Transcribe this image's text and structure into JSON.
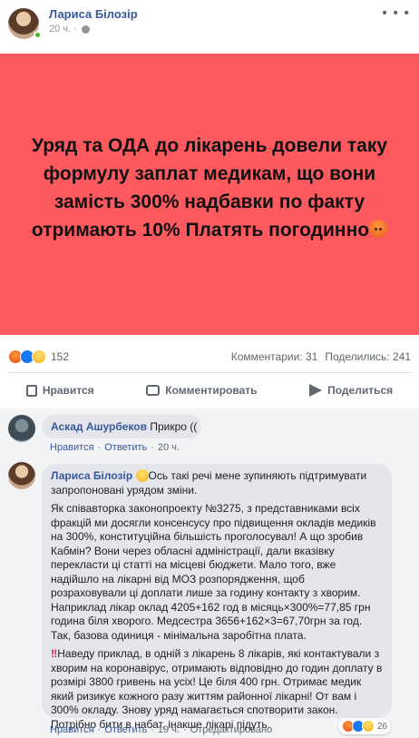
{
  "post": {
    "author": "Лариса Білозір",
    "time": "20 ч.",
    "more": "• • •",
    "card_text": "Уряд та ОДА до лікарень довели таку формулу заплат медикам, що вони замість 300% надбавки по факту отримають 10% Платять погодинно"
  },
  "reactions": {
    "icons": [
      "angry-icon",
      "like-icon",
      "sad-icon"
    ],
    "count": "152",
    "comments": "Комментарии: 31",
    "shares": "Поделились: 241"
  },
  "actions": {
    "like": "Нравится",
    "comment": "Комментировать",
    "share": "Поделиться"
  },
  "comments": [
    {
      "author": "Аскад Ашурбеков",
      "text": "Прикро ((",
      "like": "Нравится",
      "reply": "Ответить",
      "time": "20 ч."
    },
    {
      "author": "Лариса Білозір",
      "intro": "Ось такі речі мене зупиняють підтримувати запропоновані урядом зміни.",
      "para1": "Як співавторка законопроекту №3275, з представниками всіх фракцій ми досягли консенсусу про підвищення окладів медиків на 300%, конституційна більшість проголосувал! А що зробив Кабмін? Вони через обласні адміністрації, дали вказівку перекласти ці статті на місцеві бюджети. Мало того, вже надійшло на лікарні від МОЗ розпорядження, щоб розраховували ці доплати лише за годину контакту з хворим. Наприклад лікар оклад 4205+162 год в місяць×300%=77,85 грн година біля хворого. Медсестра 3656+162×3=67,70грн за год. Так, базова одиниця - мінімальна заробітна плата.",
      "bang": "‼",
      "para2": "Наведу приклад, в одній з лікарень 8 лікарів, які контактували з хворим на коронавірус, отримають відповідно до годин доплату в розмірі 3800 гривень на усіх! Це біля 400 грн. Отримає медик який ризикує кожного разу життям районної лікарні! От вам і 300% окладу. Знову уряд намагається спотворити закон. Потрібно бити в набат, інакше лікарі підуть.",
      "like": "Нравится",
      "reply": "Ответить",
      "time": "19 ч.",
      "edited": "Отредактировано",
      "react_count": "26"
    }
  ]
}
